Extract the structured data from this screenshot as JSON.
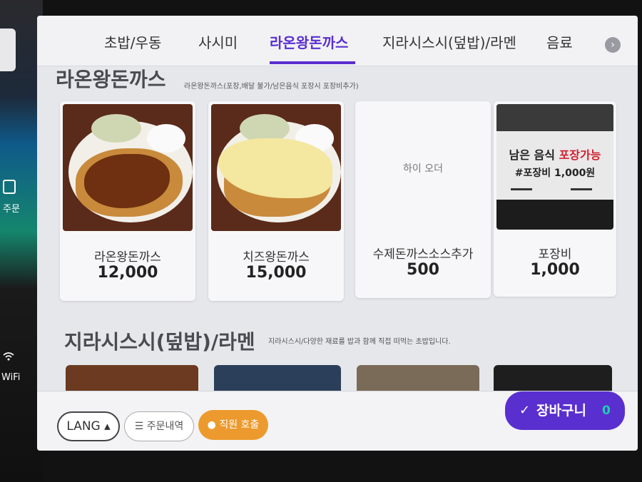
{
  "side": {
    "order_label": "주문",
    "wifi_label": "WiFi"
  },
  "tabs": [
    {
      "label": "초밥/우동"
    },
    {
      "label": "사시미"
    },
    {
      "label": "라온왕돈까스"
    },
    {
      "label": "지라시스시(덮밥)/라멘"
    },
    {
      "label": "음료"
    }
  ],
  "section1": {
    "title": "라온왕돈까스",
    "description": "라온왕돈까스(포장,배달 불가/남은음식 포장시 포장비추가)"
  },
  "items": [
    {
      "name": "라온왕돈까스",
      "price": "12,000"
    },
    {
      "name": "치즈왕돈까스",
      "price": "15,000"
    },
    {
      "name": "수제돈까스소스추가",
      "price": "500",
      "placeholder": "하이 오더"
    },
    {
      "name": "포장비",
      "price": "1,000"
    }
  ],
  "banner": {
    "line1_prefix": "남은 음식 ",
    "line1_highlight": "포장가능",
    "line2": "#포장비 1,000원"
  },
  "section2": {
    "title": "지라시스시(덮밥)/라멘",
    "description": "지라시스시/다양한 재료를 밥과 함께 직접 떠먹는 초밥입니다."
  },
  "bottom": {
    "lang_label": "LANG ▴",
    "history_label": "주문내역",
    "call_label": "직원 호출",
    "cart_label": "장바구니",
    "cart_count": "0"
  },
  "colors": {
    "accent": "#5a2fd0",
    "call_button": "#ec9a2e",
    "cart_count": "#1bd0b0"
  }
}
